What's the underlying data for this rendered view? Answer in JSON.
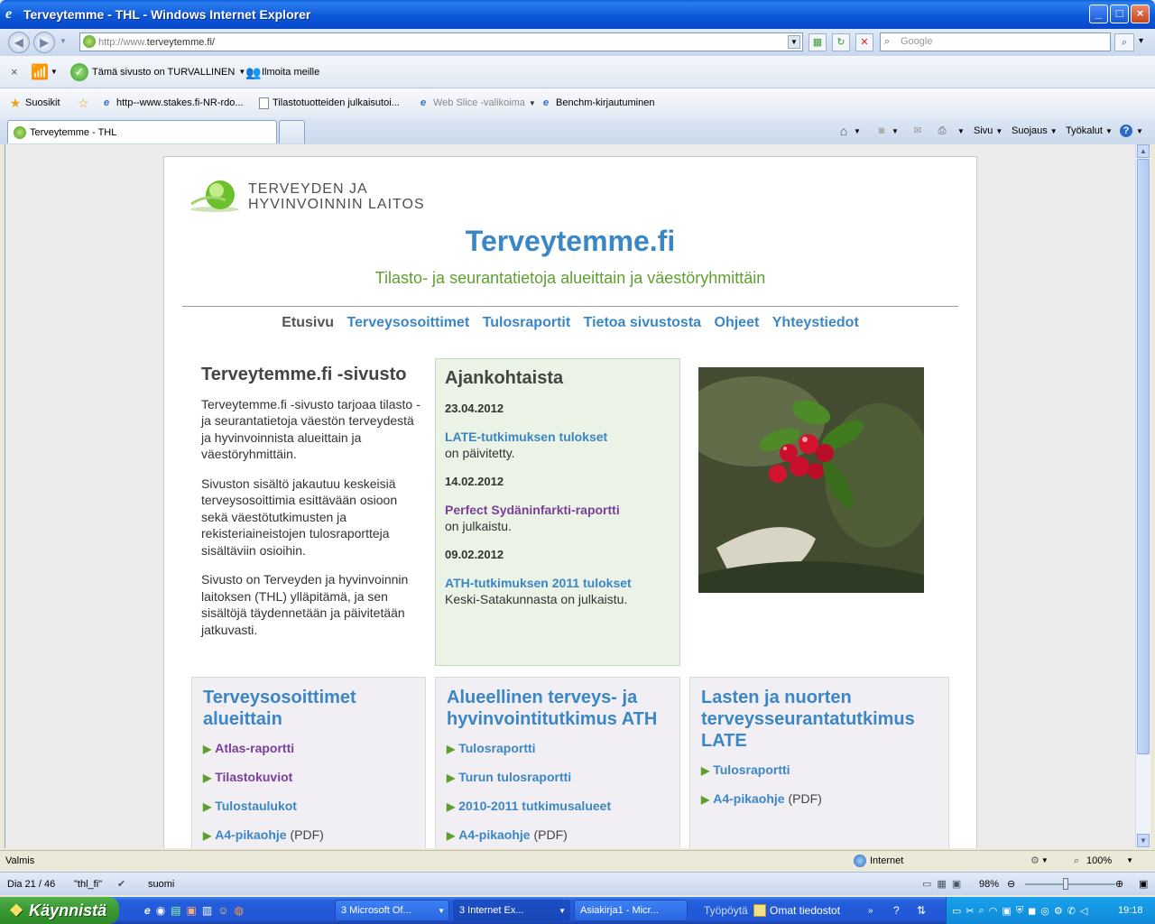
{
  "window": {
    "title": "Terveytemme - THL - Windows Internet Explorer"
  },
  "address": {
    "url_prefix": "http://www.",
    "url_domain": "terveytemme.fi/",
    "search_placeholder": "Google"
  },
  "toolbar": {
    "safe_label": "Tämä sivusto on TURVALLINEN",
    "report_label": "Ilmoita meille"
  },
  "favorites": {
    "label": "Suosikit",
    "items": [
      "http--www.stakes.fi-NR-rdo...",
      "Tilastotuotteiden julkaisutoi...",
      "Web Slice -valikoima",
      "Benchm-kirjautuminen"
    ]
  },
  "tabs": {
    "active": "Terveytemme - THL"
  },
  "command_bar": {
    "page": "Sivu",
    "safety": "Suojaus",
    "tools": "Työkalut"
  },
  "site": {
    "logo_line1": "TERVEYDEN JA",
    "logo_line2": "HYVINVOINNIN LAITOS",
    "title": "Terveytemme.fi",
    "subtitle": "Tilasto- ja seurantatietoja alueittain ja väestöryhmittäin",
    "nav": [
      "Etusivu",
      "Terveysosoittimet",
      "Tulosraportit",
      "Tietoa sivustosta",
      "Ohjeet",
      "Yhteystiedot"
    ],
    "intro": {
      "heading": "Terveytemme.fi -sivusto",
      "p1": "Terveytemme.fi -sivusto tarjoaa tilasto - ja seurantatietoja väestön terveydestä ja hyvinvoinnista alueittain ja väestöryhmittäin.",
      "p2": "Sivuston sisältö jakautuu keskeisiä terveysosoittimia esittävään osioon sekä väestötutkimusten ja rekisteriaineistojen tulosraportteja sisältäviin osioihin.",
      "p3": "Sivusto on Terveyden ja hyvinvoinnin laitoksen (THL) ylläpitämä, ja sen sisältöjä täydennetään ja päivitetään jatkuvasti."
    },
    "news": {
      "heading": "Ajankohtaista",
      "items": [
        {
          "date": "23.04.2012",
          "link": "LATE-tutkimuksen tulokset",
          "text": "on päivitetty."
        },
        {
          "date": "14.02.2012",
          "link": "Perfect Sydäninfarkti-raportti",
          "text": "on julkaistu."
        },
        {
          "date": "09.02.2012",
          "link": "ATH-tutkimuksen 2011 tulokset",
          "text": "Keski-Satakunnasta on julkaistu."
        }
      ]
    },
    "boxes": [
      {
        "title": "Terveysosoittimet alueittain",
        "items": [
          "Atlas-raportti",
          "Tilastokuviot",
          "Tulostaulukot",
          "A4-pikaohje"
        ],
        "pdf": "(PDF)"
      },
      {
        "title": "Alueellinen terveys- ja hyvinvointitutkimus ATH",
        "items": [
          "Tulosraportti",
          "Turun tulosraportti",
          "2010-2011 tutkimusalueet",
          "A4-pikaohje"
        ],
        "pdf": "(PDF)"
      },
      {
        "title": "Lasten ja nuorten terveysseurantatutkimus LATE",
        "items": [
          "Tulosraportti",
          "A4-pikaohje"
        ],
        "pdf": "(PDF)"
      }
    ]
  },
  "status": {
    "text": "Valmis",
    "zone": "Internet",
    "zoom": "100%"
  },
  "ppt": {
    "slide": "Dia 21 / 46",
    "theme": "\"thl_fi\"",
    "lang": "suomi",
    "zoom": "98%"
  },
  "taskbar": {
    "start": "Käynnistä",
    "tasks": [
      "3 Microsoft Of...",
      "3 Internet Ex...",
      "Asiakirja1 - Micr..."
    ],
    "desktop": "Työpöytä",
    "mydocs": "Omat tiedostot",
    "clock": "19:18"
  }
}
